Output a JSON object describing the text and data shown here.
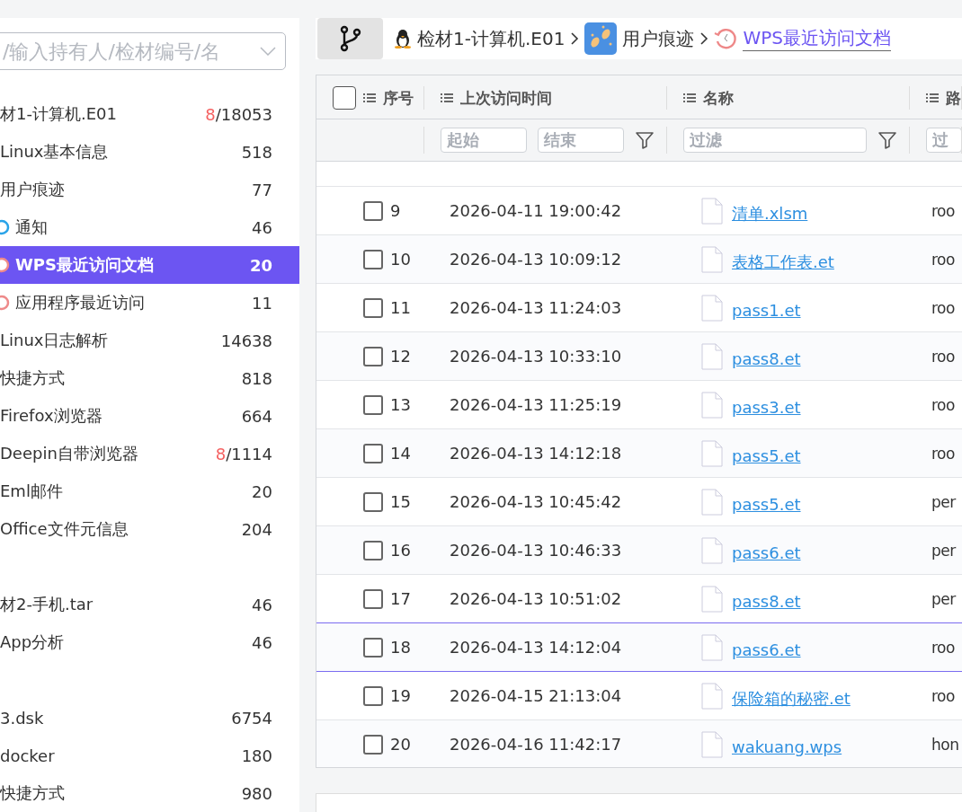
{
  "sidebar": {
    "search": {
      "placeholder": "/输入持有人/检材编号/名"
    },
    "items": [
      {
        "label": "材1-计算机.E01",
        "flagged": "8",
        "count": "/18053",
        "children": [
          {
            "label": "Linux基本信息",
            "count": "518"
          },
          {
            "label": "用户痕迹",
            "count": "77",
            "children": [
              {
                "label": "通知",
                "count": "46",
                "kind": "notice",
                "selected": false
              },
              {
                "label": "WPS最近访问文档",
                "count": "20",
                "kind": "history",
                "selected": true
              },
              {
                "label": "应用程序最近访问",
                "count": "11",
                "kind": "history",
                "selected": false
              }
            ]
          },
          {
            "label": "Linux日志解析",
            "count": "14638"
          },
          {
            "label": "快捷方式",
            "count": "818"
          },
          {
            "label": "Firefox浏览器",
            "count": "664"
          },
          {
            "label": "Deepin自带浏览器",
            "flagged": "8",
            "count": "/1114"
          },
          {
            "label": "Eml邮件",
            "count": "20"
          },
          {
            "label": "Office文件元信息",
            "count": "204"
          }
        ]
      },
      {
        "label": "材2-手机.tar",
        "count": "46",
        "children": [
          {
            "label": "App分析",
            "count": "46"
          }
        ]
      },
      {
        "label": "3.dsk",
        "count": "6754",
        "children": [
          {
            "label": "docker",
            "count": "180"
          },
          {
            "label": "快捷方式",
            "count": "980"
          }
        ]
      }
    ]
  },
  "breadcrumb": [
    {
      "label": "检材1-计算机.E01",
      "kind": "linux"
    },
    {
      "label": "用户痕迹",
      "kind": "footprints"
    },
    {
      "label": "WPS最近访问文档",
      "kind": "history"
    }
  ],
  "table": {
    "all_checked": false,
    "columns": [
      {
        "label": "序号"
      },
      {
        "label": "上次访问时间",
        "filters": [
          {
            "placeholder": "起始"
          },
          {
            "placeholder": "结束"
          }
        ]
      },
      {
        "label": "名称",
        "filters": [
          {
            "placeholder": "过滤"
          }
        ]
      },
      {
        "label": "路",
        "filters": [
          {
            "placeholder": "过"
          }
        ]
      }
    ],
    "rows": [
      {
        "index": "9",
        "time": "2026-04-11 19:00:42",
        "name": "清单.xlsm",
        "path": "roo",
        "checked": false,
        "selected": false
      },
      {
        "index": "10",
        "time": "2026-04-13 10:09:12",
        "name": "表格工作表.et",
        "path": "roo",
        "checked": false,
        "selected": false
      },
      {
        "index": "11",
        "time": "2026-04-13 11:24:03",
        "name": "pass1.et",
        "path": "roo",
        "checked": false,
        "selected": false
      },
      {
        "index": "12",
        "time": "2026-04-13 10:33:10",
        "name": "pass8.et",
        "path": "roo",
        "checked": false,
        "selected": false
      },
      {
        "index": "13",
        "time": "2026-04-13 11:25:19",
        "name": "pass3.et",
        "path": "roo",
        "checked": false,
        "selected": false
      },
      {
        "index": "14",
        "time": "2026-04-13 14:12:18",
        "name": "pass5.et",
        "path": "roo",
        "checked": false,
        "selected": false
      },
      {
        "index": "15",
        "time": "2026-04-13 10:45:42",
        "name": "pass5.et",
        "path": "per",
        "checked": false,
        "selected": false
      },
      {
        "index": "16",
        "time": "2026-04-13 10:46:33",
        "name": "pass6.et",
        "path": "per",
        "checked": false,
        "selected": false
      },
      {
        "index": "17",
        "time": "2026-04-13 10:51:02",
        "name": "pass8.et",
        "path": "per",
        "checked": false,
        "selected": false
      },
      {
        "index": "18",
        "time": "2026-04-13 14:12:04",
        "name": "pass6.et",
        "path": "roo",
        "checked": false,
        "selected": true
      },
      {
        "index": "19",
        "time": "2026-04-15 21:13:04",
        "name": "保险箱的秘密.et",
        "path": "roo",
        "checked": false,
        "selected": false
      },
      {
        "index": "20",
        "time": "2026-04-16 11:42:17",
        "name": "wakuang.wps",
        "path": "hon",
        "checked": false,
        "selected": false
      }
    ]
  }
}
